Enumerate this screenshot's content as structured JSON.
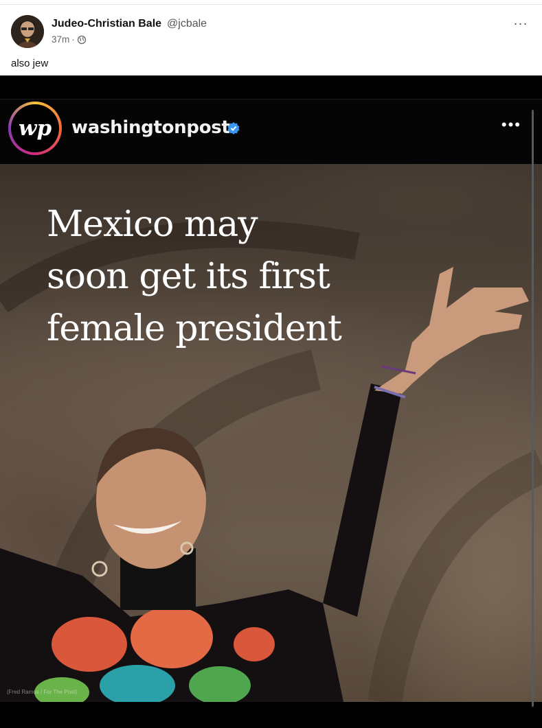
{
  "author": {
    "name": "Judeo-Christian Bale",
    "handle": "@jcbale",
    "timestamp": "37m",
    "separator": "·",
    "visibility_icon": "globe-icon"
  },
  "post": {
    "text": "also jew",
    "more_label": "···"
  },
  "embed": {
    "account": "washingtonpost",
    "logo_text": "wp",
    "more_label": "•••",
    "headline_lines": [
      "Mexico may",
      "soon get its first",
      "female president"
    ],
    "photo_credit": "(Fred Ramos / For The Post)"
  },
  "colors": {
    "verified": "#3897f0",
    "header_bg": "#050505",
    "text_primary": "#111111"
  }
}
